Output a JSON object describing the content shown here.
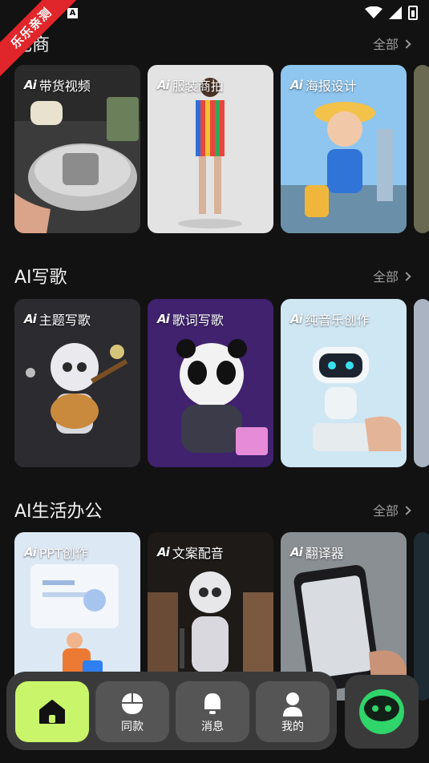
{
  "status": {
    "badge": "A"
  },
  "ribbon": {
    "text": "乐乐亲测"
  },
  "sections": [
    {
      "title": "电商",
      "all_label": "全部",
      "cards": [
        {
          "ai": "Ai",
          "label": "带货视频"
        },
        {
          "ai": "Ai",
          "label": "服装商拍"
        },
        {
          "ai": "Ai",
          "label": "海报设计"
        }
      ]
    },
    {
      "title": "AI写歌",
      "all_label": "全部",
      "cards": [
        {
          "ai": "Ai",
          "label": "主题写歌"
        },
        {
          "ai": "Ai",
          "label": "歌词写歌"
        },
        {
          "ai": "Ai",
          "label": "纯音乐创作"
        }
      ]
    },
    {
      "title": "AI生活办公",
      "all_label": "全部",
      "cards": [
        {
          "ai": "Ai",
          "label": "PPT创作"
        },
        {
          "ai": "Ai",
          "label": "文案配音"
        },
        {
          "ai": "Ai",
          "label": "翻译器"
        }
      ]
    }
  ],
  "tabs": [
    {
      "label": ""
    },
    {
      "label": "同款"
    },
    {
      "label": "消息"
    },
    {
      "label": "我的"
    }
  ],
  "colors": {
    "accent": "#c8f56a",
    "background": "#121212"
  }
}
